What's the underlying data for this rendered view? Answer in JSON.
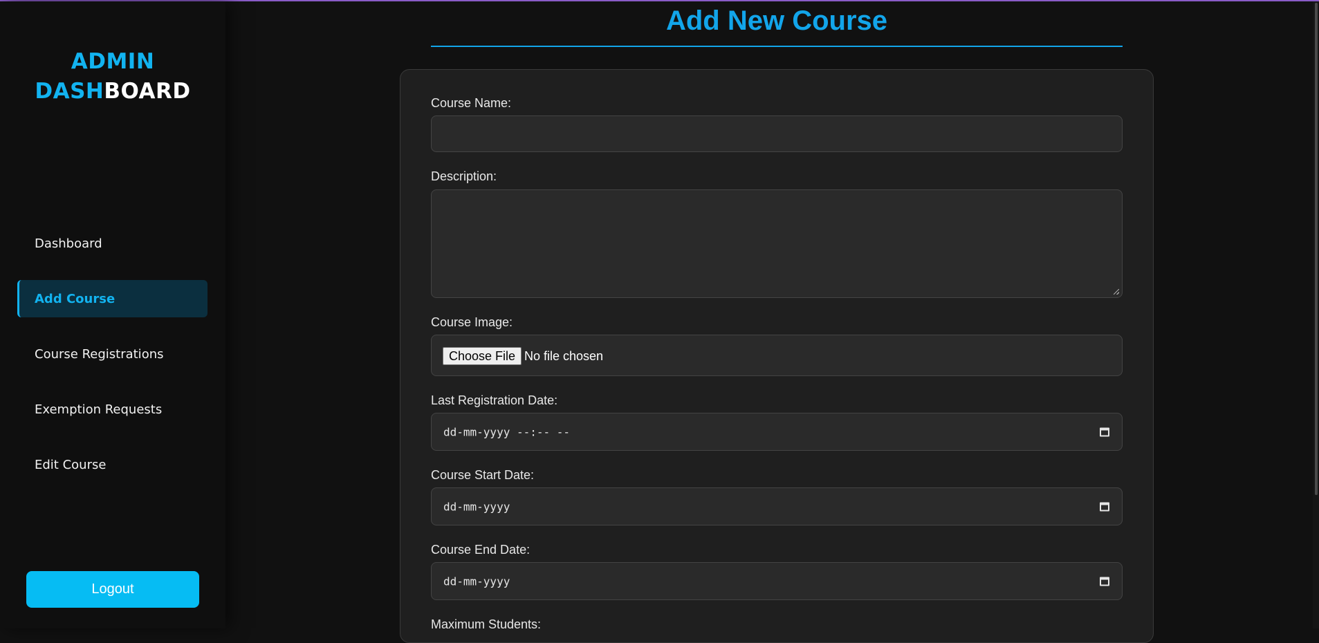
{
  "brand": {
    "line1": "ADMIN",
    "line2_blue": "DASH",
    "line2_white": "BOARD"
  },
  "sidebar": {
    "items": [
      {
        "label": "Dashboard",
        "active": false
      },
      {
        "label": "Add Course",
        "active": true
      },
      {
        "label": "Course Registrations",
        "active": false
      },
      {
        "label": "Exemption Requests",
        "active": false
      },
      {
        "label": "Edit Course",
        "active": false
      }
    ],
    "logout_label": "Logout"
  },
  "main": {
    "title": "Add New Course",
    "form": {
      "course_name": {
        "label": "Course Name:",
        "value": ""
      },
      "description": {
        "label": "Description:",
        "value": ""
      },
      "course_image": {
        "label": "Course Image:",
        "button": "Choose File",
        "status": "No file chosen"
      },
      "last_registration_date": {
        "label": "Last Registration Date:",
        "placeholder": "dd-mm-yyyy --:-- --"
      },
      "course_start_date": {
        "label": "Course Start Date:",
        "placeholder": "dd-mm-yyyy"
      },
      "course_end_date": {
        "label": "Course End Date:",
        "placeholder": "dd-mm-yyyy"
      },
      "maximum_students": {
        "label": "Maximum Students:"
      }
    }
  },
  "colors": {
    "accent": "#12b3f0",
    "logout": "#06bcf3",
    "background": "#111111",
    "card": "#1f1f1f"
  },
  "icons": {
    "calendar": "calendar-icon"
  }
}
